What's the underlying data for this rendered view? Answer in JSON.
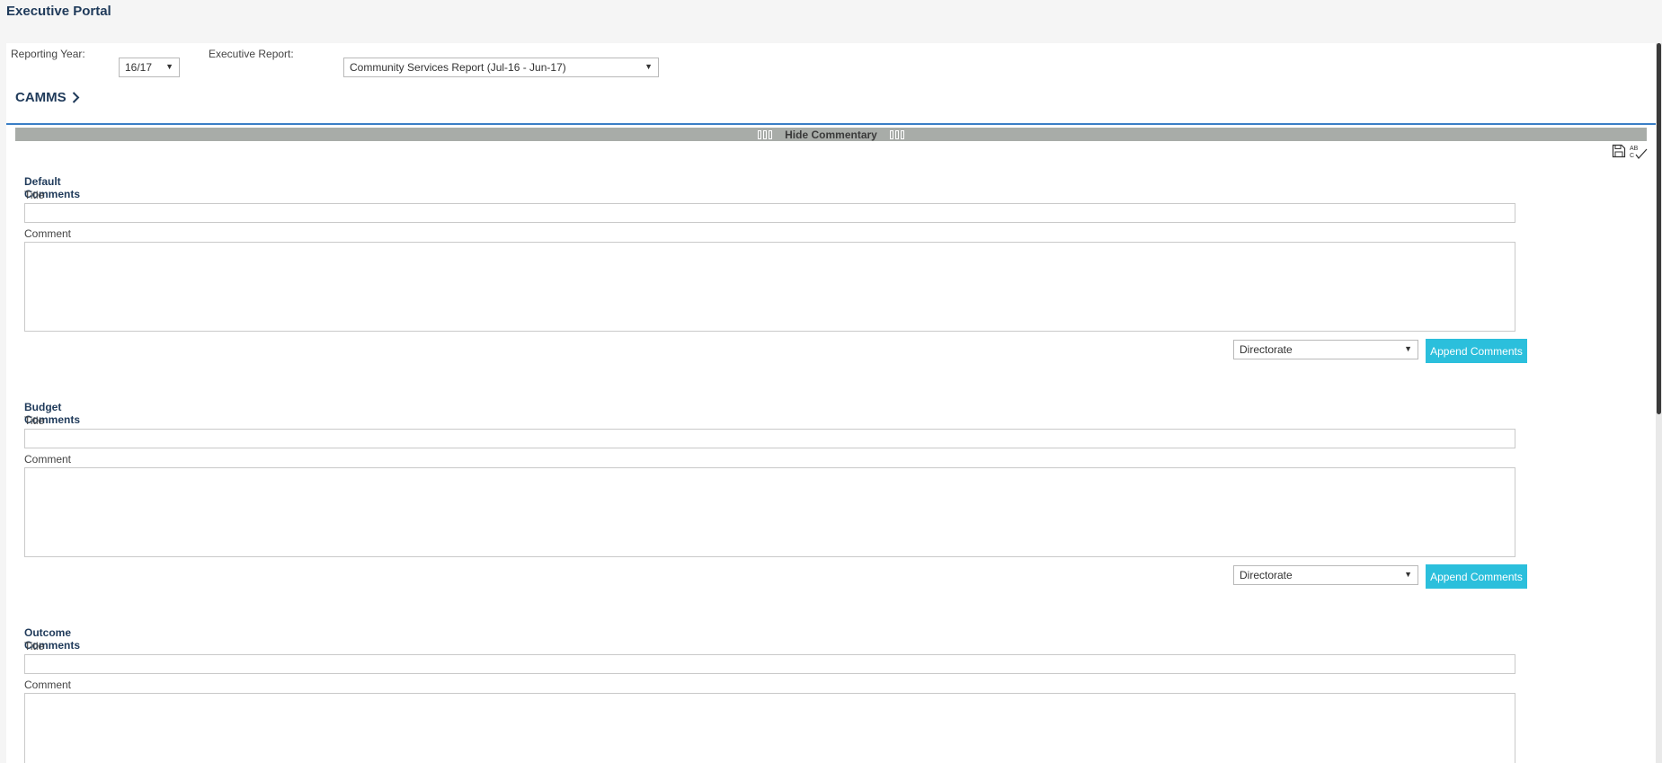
{
  "app": {
    "title": "Executive Portal"
  },
  "filters": {
    "reporting_year_label": "Reporting Year:",
    "reporting_year_value": "16/17",
    "executive_report_label": "Executive Report:",
    "executive_report_value": "Community Services Report (Jul-16 - Jun-17)"
  },
  "breadcrumb": {
    "label": "CAMMS"
  },
  "commentary_bar": {
    "label": "Hide Commentary"
  },
  "toolbar": {
    "icons": [
      "save-icon",
      "spellcheck-icon"
    ],
    "spellcheck_text": "AB C"
  },
  "sections": [
    {
      "title": "Default Comments",
      "title_label": "Title",
      "comment_label": "Comment",
      "title_value": "",
      "comment_value": "",
      "select_value": "Directorate",
      "button_label": "Append Comments"
    },
    {
      "title": "Budget Comments",
      "title_label": "Title",
      "comment_label": "Comment",
      "title_value": "",
      "comment_value": "",
      "select_value": "Directorate",
      "button_label": "Append Comments"
    },
    {
      "title": "Outcome Comments",
      "title_label": "Title",
      "comment_label": "Comment",
      "title_value": "",
      "comment_value": ""
    }
  ],
  "colors": {
    "brand_text": "#1f3a5a",
    "accent_line": "#3a7fc6",
    "button": "#2bbfdc",
    "bar": "#a8aca8"
  }
}
